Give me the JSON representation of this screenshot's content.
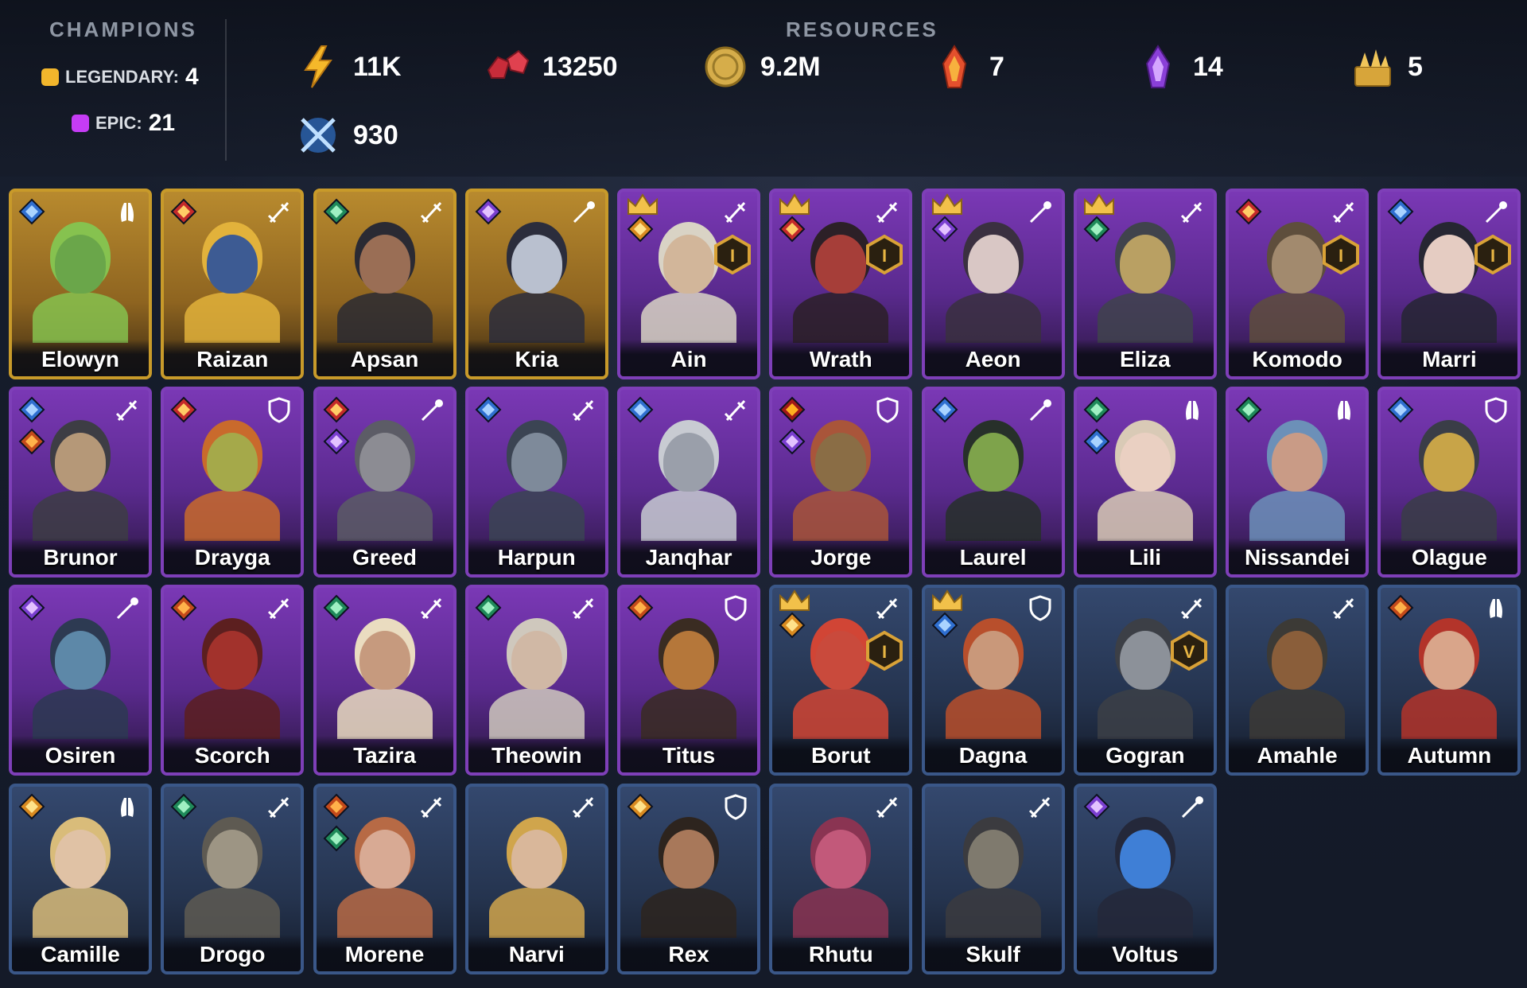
{
  "champions": {
    "title": "CHAMPIONS",
    "legendary_label": "LEGENDARY:",
    "legendary_count": "4",
    "epic_label": "EPIC:",
    "epic_count": "21"
  },
  "resources": {
    "title": "RESOURCES",
    "energy": "11K",
    "gems": "13250",
    "silver": "9.2M",
    "fire_shard": "7",
    "purple_shard": "14",
    "gold_item": "5",
    "arena_tokens": "930"
  },
  "colors": {
    "legendary": "#f2b62c",
    "epic": "#c53cf5",
    "rare": "#3a5788"
  },
  "cards": [
    {
      "name": "Elowyn",
      "rarity": "legendary",
      "affinity": "blue",
      "role": "support",
      "skin": "#6aa64a",
      "hair": "#86c24f"
    },
    {
      "name": "Raizan",
      "rarity": "legendary",
      "affinity": "red",
      "role": "attack",
      "skin": "#3d5b93",
      "hair": "#e2b23b"
    },
    {
      "name": "Apsan",
      "rarity": "legendary",
      "affinity": "green",
      "role": "attack",
      "skin": "#9a6e55",
      "hair": "#2a2a33"
    },
    {
      "name": "Kria",
      "rarity": "legendary",
      "affinity": "purple",
      "role": "magic",
      "skin": "#b9c0cf",
      "hair": "#2b2d3c"
    },
    {
      "name": "Ain",
      "rarity": "epic",
      "affinity": "gold",
      "role": "attack",
      "skin": "#d2b69a",
      "hair": "#d9d3c5",
      "crown": true,
      "badge": "I"
    },
    {
      "name": "Wrath",
      "rarity": "epic",
      "affinity": "red",
      "role": "attack",
      "skin": "#a63e39",
      "hair": "#2c2027",
      "crown": true,
      "badge": "I"
    },
    {
      "name": "Aeon",
      "rarity": "epic",
      "affinity": "purple",
      "role": "magic",
      "skin": "#d9c7c5",
      "hair": "#3a3040",
      "crown": true
    },
    {
      "name": "Eliza",
      "rarity": "epic",
      "affinity": "green",
      "role": "attack",
      "skin": "#b9a063",
      "hair": "#40434c",
      "crown": true
    },
    {
      "name": "Komodo",
      "rarity": "epic",
      "affinity": "red",
      "role": "attack",
      "skin": "#a28a6e",
      "hair": "#5e4e3c",
      "badge": "I"
    },
    {
      "name": "Marri",
      "rarity": "epic",
      "affinity": "blue",
      "role": "magic",
      "skin": "#e5ccc2",
      "hair": "#262632",
      "badge": "I"
    },
    {
      "name": "Brunor",
      "rarity": "epic",
      "affinity": "blue",
      "role": "attack",
      "skin": "#b59878",
      "hair": "#3d3d44",
      "affinity2": "fire"
    },
    {
      "name": "Drayga",
      "rarity": "epic",
      "affinity": "red",
      "role": "defense",
      "skin": "#a5a94a",
      "hair": "#c96a2c"
    },
    {
      "name": "Greed",
      "rarity": "epic",
      "affinity": "red",
      "role": "magic",
      "skin": "#8c8c93",
      "hair": "#5c5c66",
      "affinity2": "purple"
    },
    {
      "name": "Harpun",
      "rarity": "epic",
      "affinity": "blue",
      "role": "attack",
      "skin": "#7e8a9a",
      "hair": "#3b4453"
    },
    {
      "name": "Janqhar",
      "rarity": "epic",
      "affinity": "blue",
      "role": "attack",
      "skin": "#9a9faa",
      "hair": "#c8cbd2"
    },
    {
      "name": "Jorge",
      "rarity": "epic",
      "affinity": "clan",
      "role": "defense",
      "skin": "#8a6d45",
      "hair": "#a9553a",
      "affinity2": "purple"
    },
    {
      "name": "Laurel",
      "rarity": "epic",
      "affinity": "blue",
      "role": "magic",
      "skin": "#7ea34b",
      "hair": "#27302a"
    },
    {
      "name": "Lili",
      "rarity": "epic",
      "affinity": "green",
      "role": "support",
      "skin": "#ead0c2",
      "hair": "#d9cab6",
      "affinity2": "blue"
    },
    {
      "name": "Nissandei",
      "rarity": "epic",
      "affinity": "green",
      "role": "support",
      "skin": "#c99b86",
      "hair": "#6c90b8"
    },
    {
      "name": "Olague",
      "rarity": "epic",
      "affinity": "blue",
      "role": "defense",
      "skin": "#c8a448",
      "hair": "#3a3d47"
    },
    {
      "name": "Osiren",
      "rarity": "epic",
      "affinity": "purple",
      "role": "magic",
      "skin": "#5d88a8",
      "hair": "#2d3a52"
    },
    {
      "name": "Scorch",
      "rarity": "epic",
      "affinity": "fire",
      "role": "attack",
      "skin": "#a2322c",
      "hair": "#5c1f1f"
    },
    {
      "name": "Tazira",
      "rarity": "epic",
      "affinity": "green",
      "role": "attack",
      "skin": "#c69a7e",
      "hair": "#eadcc0"
    },
    {
      "name": "Theowin",
      "rarity": "epic",
      "affinity": "green",
      "role": "attack",
      "skin": "#d0b8a5",
      "hair": "#cfc8bd"
    },
    {
      "name": "Titus",
      "rarity": "epic",
      "affinity": "fire",
      "role": "defense",
      "skin": "#b5773a",
      "hair": "#3a2c22"
    },
    {
      "name": "Borut",
      "rarity": "rare",
      "affinity": "gold",
      "role": "attack",
      "skin": "#c94a3c",
      "hair": "#d14535",
      "crown": true,
      "badge": "I"
    },
    {
      "name": "Dagna",
      "rarity": "rare",
      "affinity": "blue",
      "role": "defense",
      "skin": "#c9987a",
      "hair": "#b84f2c",
      "crown": true
    },
    {
      "name": "Gogran",
      "rarity": "rare",
      "affinity": "none",
      "role": "attack",
      "skin": "#8c9199",
      "hair": "#3c3f46",
      "badge": "V"
    },
    {
      "name": "Amahle",
      "rarity": "rare",
      "affinity": "none",
      "role": "attack",
      "skin": "#8a5e3a",
      "hair": "#3c3a36"
    },
    {
      "name": "Autumn",
      "rarity": "rare",
      "affinity": "fire",
      "role": "support",
      "skin": "#d9a58a",
      "hair": "#b3342a"
    },
    {
      "name": "Camille",
      "rarity": "rare",
      "affinity": "gold",
      "role": "support",
      "skin": "#e0c2a5",
      "hair": "#d9bc7a"
    },
    {
      "name": "Drogo",
      "rarity": "rare",
      "affinity": "green",
      "role": "attack",
      "skin": "#9d9584",
      "hair": "#5e5a52"
    },
    {
      "name": "Morene",
      "rarity": "rare",
      "affinity": "fire",
      "role": "attack",
      "skin": "#d8aa94",
      "hair": "#b76a45",
      "affinity2": "green"
    },
    {
      "name": "Narvi",
      "rarity": "rare",
      "affinity": "none",
      "role": "attack",
      "skin": "#d9b79a",
      "hair": "#d0a54c"
    },
    {
      "name": "Rex",
      "rarity": "rare",
      "affinity": "gold",
      "role": "defense",
      "skin": "#a8785a",
      "hair": "#2d241e"
    },
    {
      "name": "Rhutu",
      "rarity": "rare",
      "affinity": "none",
      "role": "attack",
      "skin": "#c2597a",
      "hair": "#8a3452"
    },
    {
      "name": "Skulf",
      "rarity": "rare",
      "affinity": "none",
      "role": "attack",
      "skin": "#7f7a6e",
      "hair": "#3b3b3f"
    },
    {
      "name": "Voltus",
      "rarity": "rare",
      "affinity": "purple",
      "role": "magic",
      "skin": "#3f7fd6",
      "hair": "#24283a"
    }
  ]
}
